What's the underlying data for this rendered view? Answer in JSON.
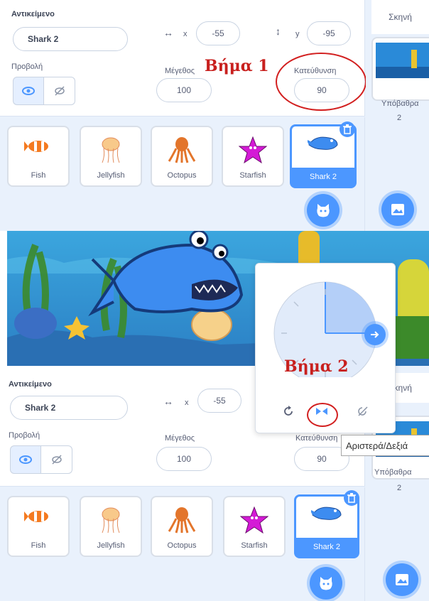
{
  "top_panel": {
    "sprite_label": "Αντικείμενο",
    "sprite_name": "Shark 2",
    "x_label": "x",
    "x_value": "-55",
    "y_label": "y",
    "y_value": "-95",
    "show_label": "Προβολή",
    "size_label": "Μέγεθος",
    "size_value": "100",
    "direction_label": "Κατεύθυνση",
    "direction_value": "90",
    "step_annotation": "Βήμα 1",
    "stage_header": "Σκηνή",
    "backdrops_label": "Υπόβαθρα",
    "backdrops_count": "2"
  },
  "bottom_panel": {
    "sprite_label": "Αντικείμενο",
    "sprite_name": "Shark 2",
    "x_label": "x",
    "x_value": "-55",
    "show_label": "Προβολή",
    "size_label": "Μέγεθος",
    "size_value": "100",
    "direction_label": "Κατεύθυνση",
    "direction_value": "90",
    "stage_header": "Σκηνή",
    "backdrops_label": "Υπόβαθρα",
    "backdrops_count": "2"
  },
  "sprites": [
    {
      "name": "Fish"
    },
    {
      "name": "Jellyfish"
    },
    {
      "name": "Octopus"
    },
    {
      "name": "Starfish"
    },
    {
      "name": "Shark 2",
      "selected": true
    }
  ],
  "popup": {
    "step_annotation": "Βήμα 2",
    "tooltip": "Αριστερά/Δεξιά"
  },
  "colors": {
    "accent": "#4c97ff",
    "annotation": "#c8201e",
    "panel_bg": "#e9f1fc"
  },
  "icons": [
    "eye-icon",
    "eye-slash-icon",
    "horizontal-arrows-icon",
    "vertical-arrows-icon",
    "trash-icon",
    "choose-sprite-icon",
    "choose-backdrop-icon",
    "all-around-icon",
    "left-right-icon",
    "dont-rotate-icon",
    "direction-arrow-icon"
  ]
}
